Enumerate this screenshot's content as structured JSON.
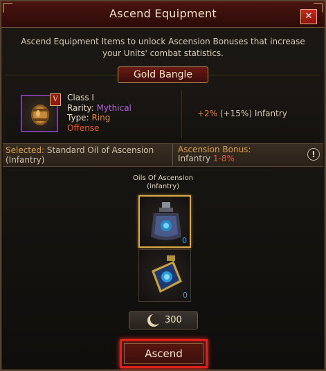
{
  "dialog": {
    "title": "Ascend Equipment",
    "close_label": "✕",
    "description_line1": "Ascend Equipment Items to unlock Ascension Bonuses that increase",
    "description_line2": "your Units' combat statistics."
  },
  "item": {
    "name": "Gold Bangle",
    "icon": "gold-bangle-icon",
    "badge": "V",
    "class_text": "Class I",
    "rarity_label": "Rarity:",
    "rarity_value": "Mythical",
    "type_label": "Type:",
    "type_value": "Ring",
    "category": "Offense",
    "bonus_pct": "+2%",
    "bonus_rest": "(+15%) Infantry"
  },
  "selection": {
    "label": "Selected:",
    "value_line1": "Standard Oil of Ascension",
    "value_line2": "(Infantry)",
    "bonus_title": "Ascension Bonus:",
    "bonus_unit": "Infantry",
    "bonus_range": "1-8%",
    "info_label": "!"
  },
  "oils": {
    "title_line1": "Oils Of Ascension",
    "title_line2": "(Infantry)",
    "items": [
      {
        "icon": "standard-oil-flask-icon",
        "count": "0",
        "selected": true
      },
      {
        "icon": "greater-oil-flask-icon",
        "count": "0",
        "selected": false
      }
    ]
  },
  "cost": {
    "icon": "crescent-coin-icon",
    "value": "300"
  },
  "actions": {
    "ascend_label": "Ascend"
  },
  "colors": {
    "accent_red": "#e0201a",
    "mythical": "#b065e0",
    "count_blue": "#3fa4e8"
  }
}
